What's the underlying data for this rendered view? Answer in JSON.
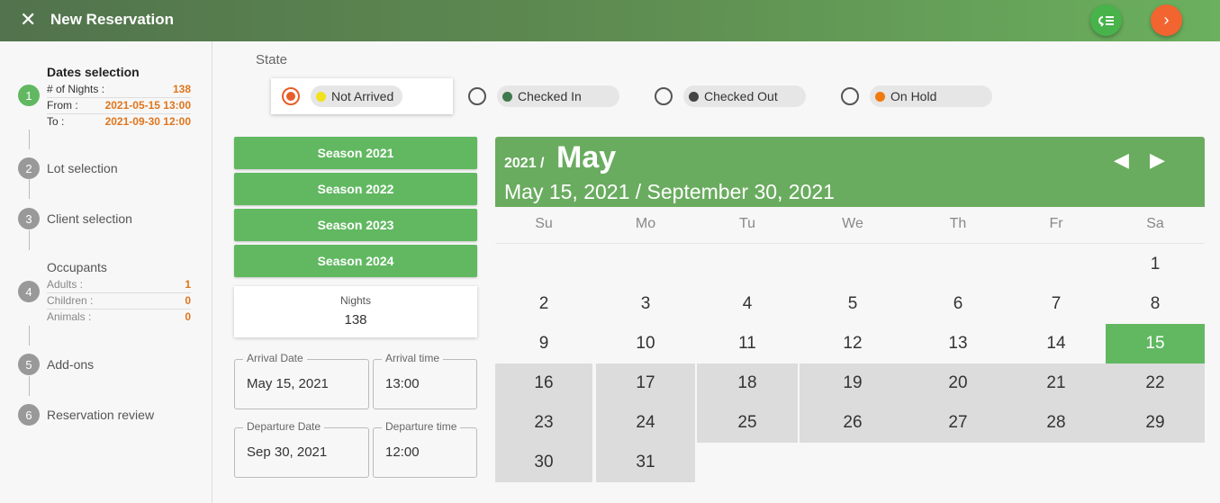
{
  "header": {
    "title": "New Reservation"
  },
  "steps": [
    {
      "num": "1",
      "label": "Dates selection"
    },
    {
      "num": "2",
      "label": "Lot selection"
    },
    {
      "num": "3",
      "label": "Client selection"
    },
    {
      "num": "4",
      "label": "Occupants"
    },
    {
      "num": "5",
      "label": "Add-ons"
    },
    {
      "num": "6",
      "label": "Reservation review"
    }
  ],
  "dates_summary": {
    "nights_label": "# of Nights :",
    "nights": "138",
    "from_label": "From :",
    "from": "2021-05-15 13:00",
    "to_label": "To :",
    "to": "2021-09-30 12:00"
  },
  "occupants": {
    "adults_label": "Adults :",
    "adults": "1",
    "children_label": "Children :",
    "children": "0",
    "animals_label": "Animals :",
    "animals": "0"
  },
  "state": {
    "label": "State",
    "options": [
      {
        "label": "Not Arrived",
        "color": "#f0e21c",
        "selected": true
      },
      {
        "label": "Checked In",
        "color": "#3e7a4d"
      },
      {
        "label": "Checked Out",
        "color": "#444444"
      },
      {
        "label": "On Hold",
        "color": "#f07a10"
      }
    ]
  },
  "seasons": [
    "Season 2021",
    "Season 2022",
    "Season 2023",
    "Season 2024"
  ],
  "nights_card": {
    "label": "Nights",
    "value": "138"
  },
  "arrival": {
    "date_label": "Arrival Date",
    "date": "May 15, 2021",
    "time_label": "Arrival time",
    "time": "13:00"
  },
  "departure": {
    "date_label": "Departure Date",
    "date": "Sep 30, 2021",
    "time_label": "Departure time",
    "time": "12:00"
  },
  "calendar": {
    "year": "2021 /",
    "month": "May",
    "range": "May 15, 2021 / September 30, 2021",
    "prev_icon": "◀",
    "next_icon": "▶",
    "weekdays": [
      "Su",
      "Mo",
      "Tu",
      "We",
      "Th",
      "Fr",
      "Sa"
    ],
    "first_weekday": 6,
    "days_in_month": 31,
    "range_start": 15
  },
  "colors": {
    "accent_green": "#61b861",
    "accent_orange": "#e0751c"
  }
}
